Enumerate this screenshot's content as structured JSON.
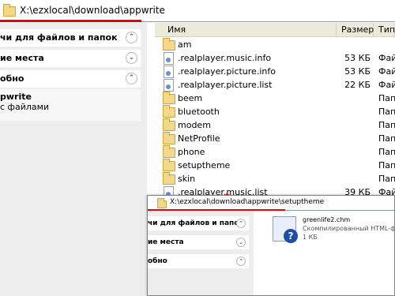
{
  "address": {
    "path": "X:\\ezxlocal\\download\\appwrite"
  },
  "left_pane": {
    "sections": [
      {
        "title": "чи для файлов и папок"
      },
      {
        "title": "ие места"
      },
      {
        "title": "обно"
      }
    ],
    "detail": {
      "name": "pwrite",
      "sub": "с файлами"
    }
  },
  "columns": {
    "name": "Имя",
    "size": "Размер",
    "type": "Тип"
  },
  "files": [
    {
      "name": "am",
      "size": "",
      "type": "",
      "icon": "folder"
    },
    {
      "name": ".realplayer.music.info",
      "size": "53 КБ",
      "type": "Файл",
      "icon": "file"
    },
    {
      "name": ".realplayer.picture.info",
      "size": "53 КБ",
      "type": "Файл",
      "icon": "file"
    },
    {
      "name": ".realplayer.picture.list",
      "size": "22 КБ",
      "type": "Файл",
      "icon": "file"
    },
    {
      "name": "beem",
      "size": "",
      "type": "Папк",
      "icon": "folder"
    },
    {
      "name": "bluetooth",
      "size": "",
      "type": "Папк",
      "icon": "folder"
    },
    {
      "name": "modem",
      "size": "",
      "type": "Папк",
      "icon": "folder"
    },
    {
      "name": "NetProfile",
      "size": "",
      "type": "Папк",
      "icon": "folder"
    },
    {
      "name": "phone",
      "size": "",
      "type": "Папк",
      "icon": "folder"
    },
    {
      "name": "setuptheme",
      "size": "",
      "type": "Папк",
      "icon": "folder"
    },
    {
      "name": "skin",
      "size": "",
      "type": "Папк",
      "icon": "folder"
    },
    {
      "name": ".realplayer.music.list",
      "size": "39 КБ",
      "type": "Файл",
      "icon": "file"
    }
  ],
  "overlay": {
    "path": "X:\\ezxlocal\\download\\appwrite\\setuptheme",
    "sections": [
      {
        "title": "чи для файлов и папок"
      },
      {
        "title": "ие места"
      },
      {
        "title": "обно"
      }
    ],
    "file": {
      "name": "greenlife2.chm",
      "desc": "Скомпилированный HTML-фа...",
      "size": "1 КБ"
    }
  },
  "colors": {
    "highlight": "#ee0000",
    "folder": "#f3d88a",
    "accent": "#1f4ea5"
  }
}
